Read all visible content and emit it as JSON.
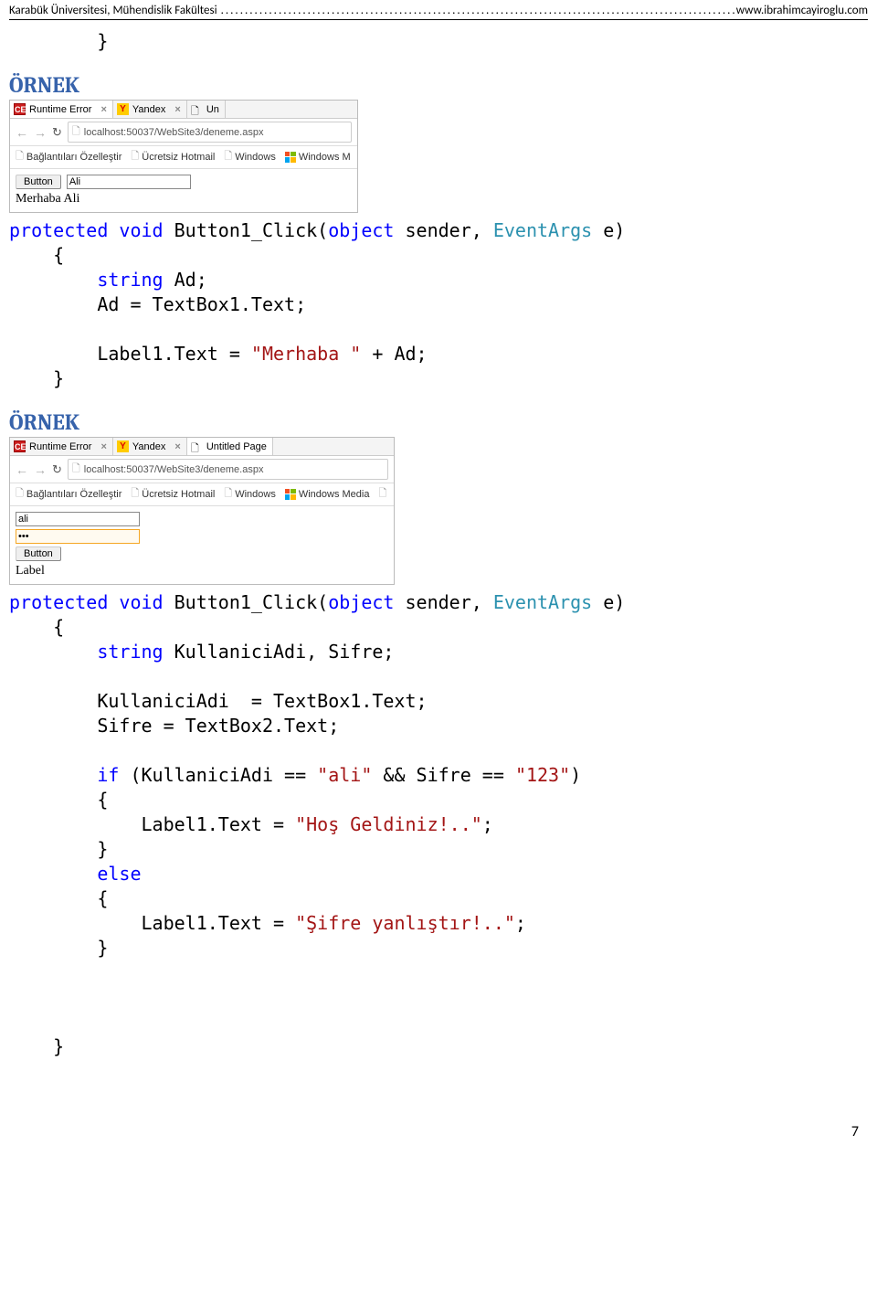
{
  "header": {
    "left": "Karabük Üniversitesi, Mühendislik Fakültesi",
    "right": "www.ibrahimcayiroglu.com"
  },
  "code_top": "        }",
  "ornek1_title": "ÖRNEK",
  "browser1": {
    "tab1": "Runtime Error",
    "tab2": "Yandex",
    "tab3": "Un",
    "url": "localhost:50037/WebSite3/deneme.aspx",
    "bm1": "Bağlantıları Özelleştir",
    "bm2": "Ücretsiz Hotmail",
    "bm3": "Windows",
    "bm4": "Windows M",
    "button_label": "Button",
    "input_value": "Ali",
    "output": "Merhaba Ali"
  },
  "code1": {
    "l1a": "protected",
    "l1b": "void",
    "l1c": " Button1_Click(",
    "l1d": "object",
    "l1e": " sender, ",
    "l1f": "EventArgs",
    "l1g": " e)",
    "l2": "    {",
    "l3a": "        ",
    "l3b": "string",
    "l3c": " Ad;",
    "l4": "        Ad = TextBox1.Text;",
    "l5": "",
    "l6a": "        Label1.Text = ",
    "l6b": "\"Merhaba \"",
    "l6c": " + Ad;",
    "l7": "    }"
  },
  "ornek2_title": "ÖRNEK",
  "browser2": {
    "tab1": "Runtime Error",
    "tab2": "Yandex",
    "tab3": "Untitled Page",
    "url": "localhost:50037/WebSite3/deneme.aspx",
    "bm1": "Bağlantıları Özelleştir",
    "bm2": "Ücretsiz Hotmail",
    "bm3": "Windows",
    "bm4": "Windows Media",
    "input1": "ali",
    "input2": "•••",
    "button_label": "Button",
    "label": "Label"
  },
  "code2": {
    "l1a": "protected",
    "l1b": "void",
    "l1c": " Button1_Click(",
    "l1d": "object",
    "l1e": " sender, ",
    "l1f": "EventArgs",
    "l1g": " e)",
    "l2": "    {",
    "l3a": "        ",
    "l3b": "string",
    "l3c": " KullaniciAdi, Sifre;",
    "l4": "",
    "l5": "        KullaniciAdi  = TextBox1.Text;",
    "l6": "        Sifre = TextBox2.Text;",
    "l7": "",
    "l8a": "        ",
    "l8b": "if",
    "l8c": " (KullaniciAdi == ",
    "l8d": "\"ali\"",
    "l8e": " && Sifre == ",
    "l8f": "\"123\"",
    "l8g": ")",
    "l9": "        {",
    "l10a": "            Label1.Text = ",
    "l10b": "\"Hoş Geldiniz!..\"",
    "l10c": ";",
    "l11": "        }",
    "l12a": "        ",
    "l12b": "else",
    "l13": "        {",
    "l14a": "            Label1.Text = ",
    "l14b": "\"Şifre yanlıştır!..\"",
    "l14c": ";",
    "l15": "        }",
    "l16": "",
    "l17": "",
    "l18": "",
    "l19": "    }"
  },
  "page_number": "7"
}
